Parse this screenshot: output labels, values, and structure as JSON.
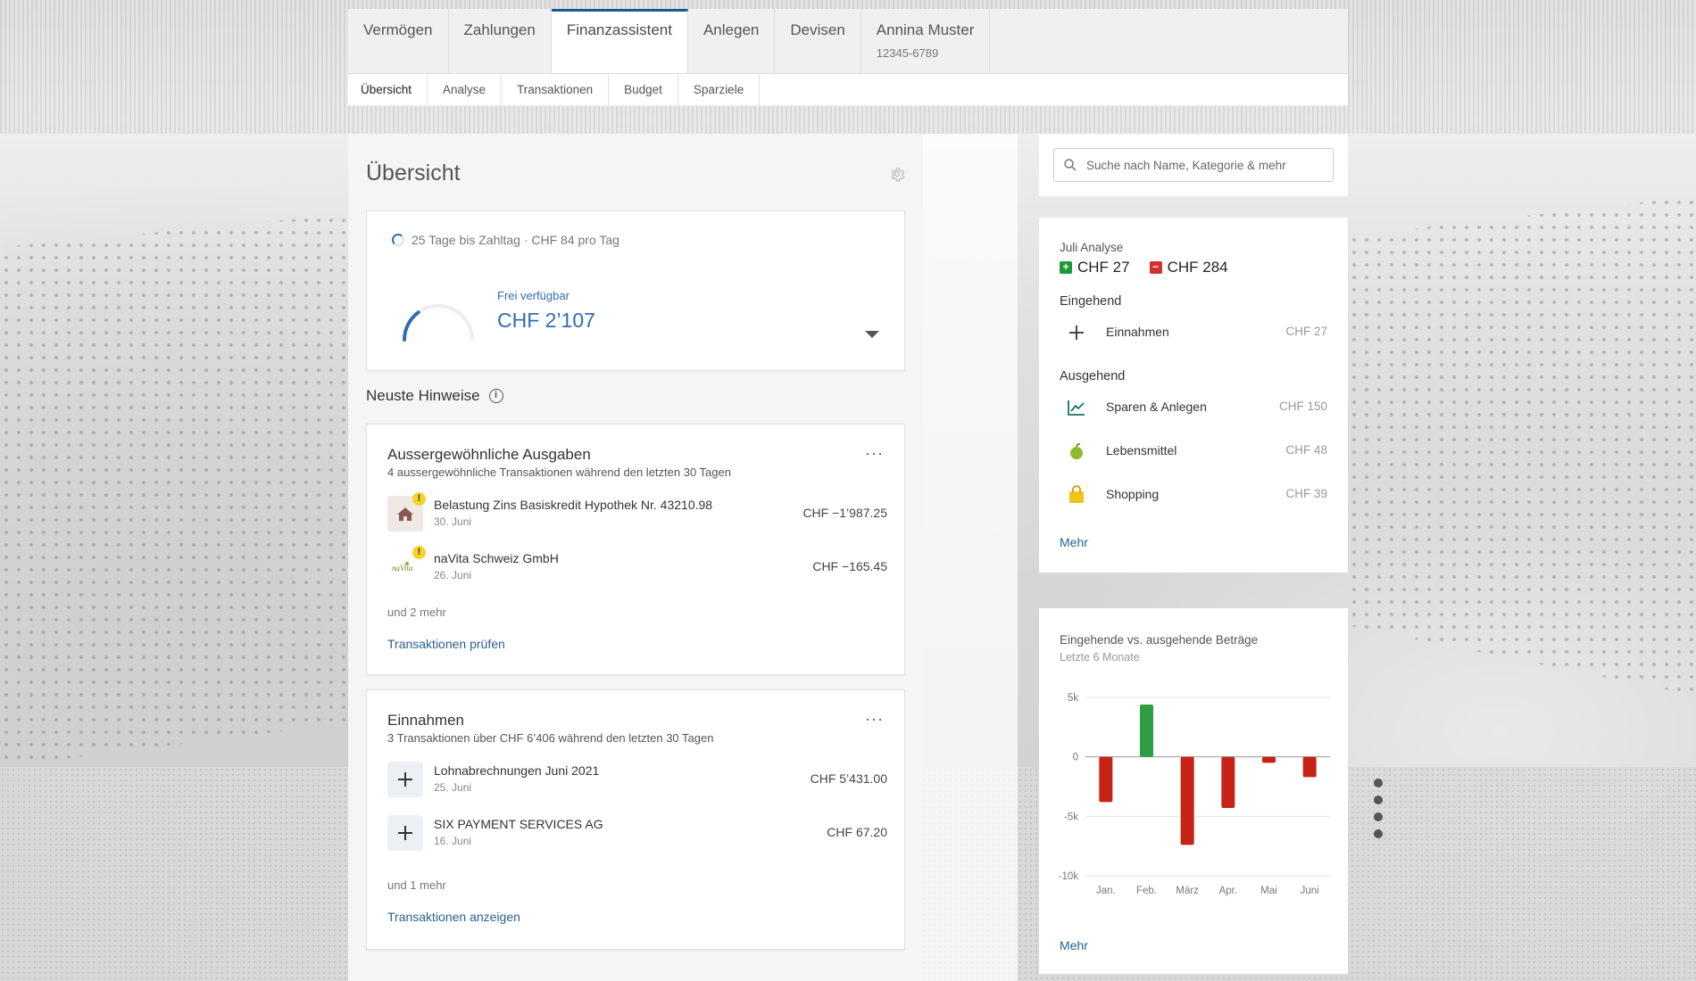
{
  "nav": {
    "tabs": [
      {
        "label": "Vermögen"
      },
      {
        "label": "Zahlungen"
      },
      {
        "label": "Finanzassistent"
      },
      {
        "label": "Anlegen"
      },
      {
        "label": "Devisen"
      },
      {
        "label": "Annina Muster",
        "sub": "12345-6789"
      }
    ],
    "active_tab": "Finanzassistent",
    "subtabs": [
      "Übersicht",
      "Analyse",
      "Transaktionen",
      "Budget",
      "Sparziele"
    ],
    "active_subtab": "Übersicht"
  },
  "main": {
    "title": "Übersicht",
    "payday": {
      "line": "25 Tage bis Zahltag · CHF 84 pro Tag",
      "free_label": "Frei verfügbar",
      "free_value": "CHF 2’107",
      "gauge_fraction": 0.3
    },
    "hints_title": "Neuste Hinweise",
    "unusual": {
      "title": "Aussergewöhnliche Ausgaben",
      "subtitle": "4 aussergewöhnliche Transaktionen während den letzten 30 Tagen",
      "transactions": [
        {
          "name": "Belastung Zins Basiskredit Hypothek Nr. 43210.98",
          "date": "30. Juni",
          "amount": "CHF −1’987.25",
          "icon": "house-icon"
        },
        {
          "name": "naVita Schweiz GmbH",
          "date": "26. Juni",
          "amount": "CHF −165.45",
          "icon": "navita-logo"
        }
      ],
      "more": "und 2 mehr",
      "link": "Transaktionen prüfen"
    },
    "income": {
      "title": "Einnahmen",
      "subtitle": "3 Transaktionen über CHF 6’406 während den letzten 30 Tagen",
      "transactions": [
        {
          "name": "Lohnabrechnungen Juni 2021",
          "date": "25. Juni",
          "amount": "CHF 5’431.00",
          "icon": "plus-icon"
        },
        {
          "name": "SIX PAYMENT SERVICES AG",
          "date": "16. Juni",
          "amount": "CHF 67.20",
          "icon": "plus-icon"
        }
      ],
      "more": "und 1 mehr",
      "link": "Transaktionen anzeigen"
    }
  },
  "search": {
    "placeholder": "Suche nach Name, Kategorie & mehr"
  },
  "analysis": {
    "title": "Juli Analyse",
    "in_total": "CHF 27",
    "out_total": "CHF 284",
    "incoming_label": "Eingehend",
    "incoming": [
      {
        "name": "Einnahmen",
        "amount": "CHF 27",
        "icon": "plus-icon"
      }
    ],
    "outgoing_label": "Ausgehend",
    "outgoing": [
      {
        "name": "Sparen & Anlegen",
        "amount": "CHF 150",
        "icon": "trend-chart-icon"
      },
      {
        "name": "Lebensmittel",
        "amount": "CHF 48",
        "icon": "apple-icon"
      },
      {
        "name": "Shopping",
        "amount": "CHF 39",
        "icon": "shopping-bag-icon"
      }
    ],
    "more": "Mehr",
    "colors": {
      "in": "#1e9a3a",
      "out": "#d32f2f"
    }
  },
  "chart_card": {
    "title": "Eingehende vs. ausgehende Beträge",
    "subtitle": "Letzte 6 Monate",
    "more": "Mehr"
  },
  "chart_data": {
    "type": "bar",
    "categories": [
      "Jan.",
      "Feb.",
      "März",
      "Apr.",
      "Mai",
      "Juni"
    ],
    "values": [
      -3800,
      4400,
      -7400,
      -4300,
      -500,
      -1700
    ],
    "ylim": [
      -10000,
      5000
    ],
    "yticks": [
      5000,
      0,
      -5000,
      -10000
    ],
    "ytick_labels": [
      "5k",
      "0",
      "-5k",
      "-10k"
    ],
    "colors": {
      "positive": "#2e9e44",
      "negative": "#c62316"
    },
    "grid": true
  }
}
